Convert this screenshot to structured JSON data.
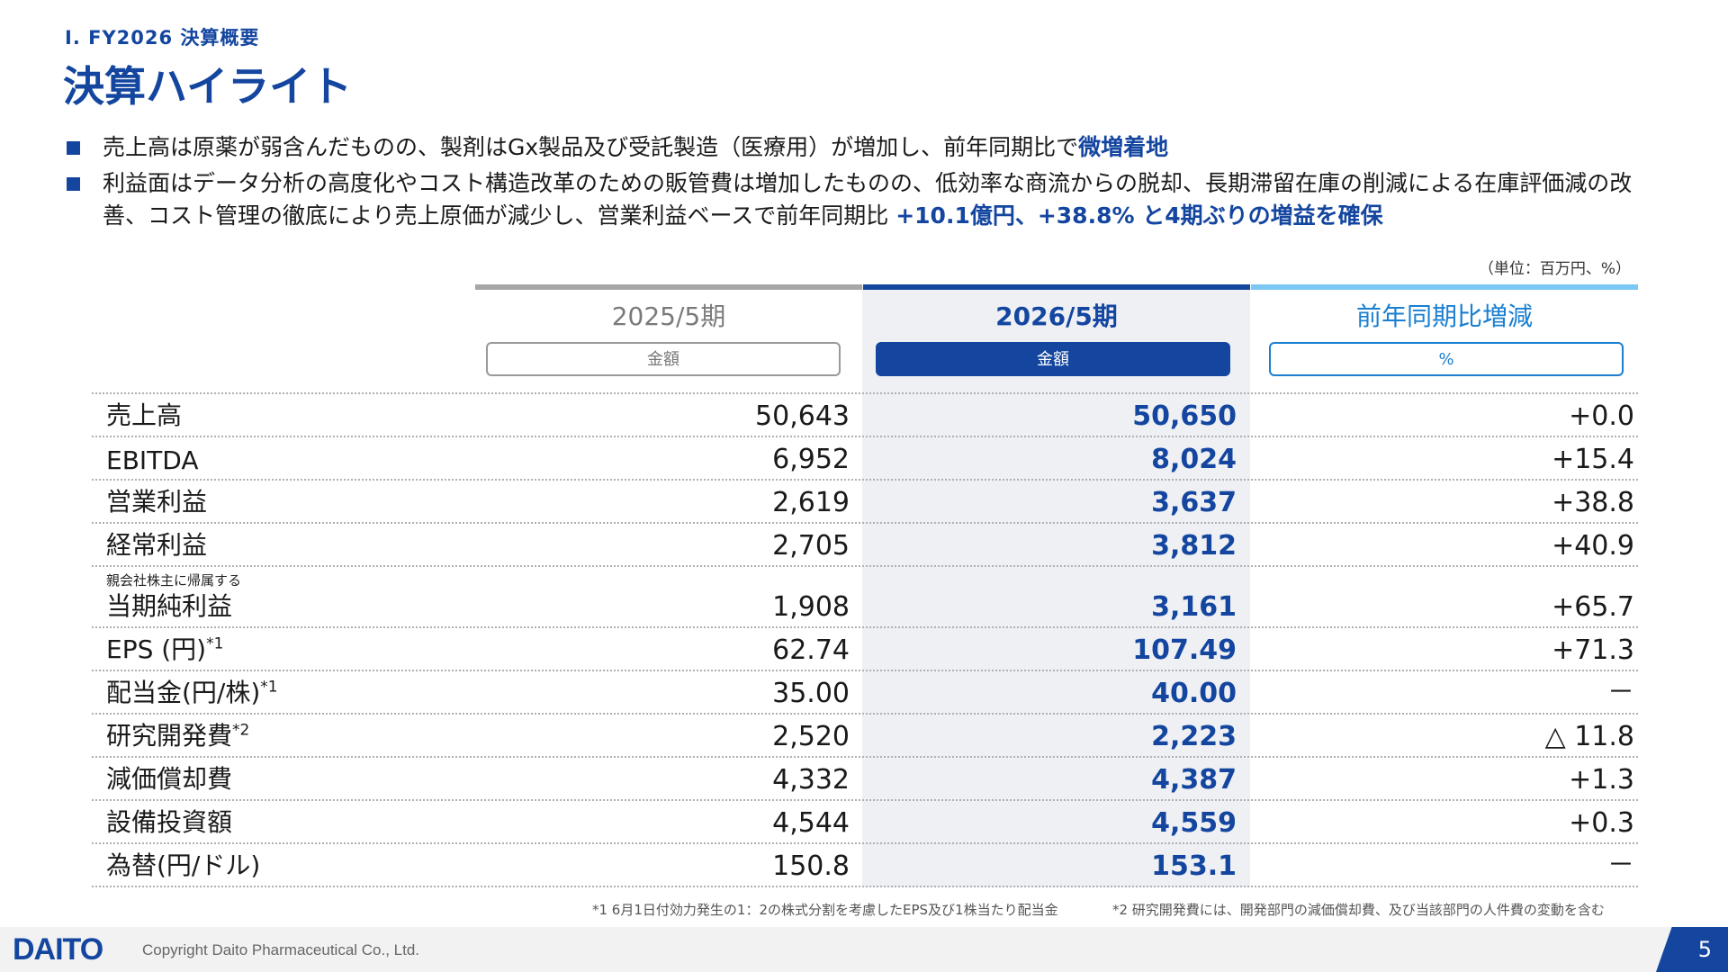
{
  "header": {
    "section": "Ⅰ. FY2026 決算概要",
    "title": "決算ハイライト"
  },
  "bullets": [
    {
      "pre": "売上高は原薬が弱含んだものの、製剤はGx製品及び受託製造（医療用）が増加し、前年同期比で",
      "hl": "微増着地",
      "post": ""
    },
    {
      "pre": "利益面はデータ分析の高度化やコスト構造改革のための販管費は増加したものの、低効率な商流からの脱却、長期滞留在庫の削減による在庫評価減の改善、コスト管理の徹底により売上原価が減少し、営業利益ベースで前年同期比 ",
      "hl": "+10.1億円、+38.8% と4期ぶりの増益を確保",
      "post": ""
    }
  ],
  "unit": "（単位：百万円、%）",
  "columns": {
    "prev": {
      "title": "2025/5期",
      "sub": "金額"
    },
    "curr": {
      "title": "2026/5期",
      "sub": "金額"
    },
    "diff": {
      "title": "前年同期比増減",
      "sub": "%"
    }
  },
  "rows": [
    {
      "label": "売上高",
      "note": "",
      "sub": "",
      "prev": "50,643",
      "curr": "50,650",
      "diff": "+0.0"
    },
    {
      "label": "EBITDA",
      "note": "",
      "sub": "",
      "prev": "6,952",
      "curr": "8,024",
      "diff": "+15.4"
    },
    {
      "label": "営業利益",
      "note": "",
      "sub": "",
      "prev": "2,619",
      "curr": "3,637",
      "diff": "+38.8"
    },
    {
      "label": "経常利益",
      "note": "",
      "sub": "",
      "prev": "2,705",
      "curr": "3,812",
      "diff": "+40.9"
    },
    {
      "label": "当期純利益",
      "note": "",
      "sub": "親会社株主に帰属する",
      "prev": "1,908",
      "curr": "3,161",
      "diff": "+65.7"
    },
    {
      "label": "EPS (円)",
      "note": "*1",
      "sub": "",
      "prev": "62.74",
      "curr": "107.49",
      "diff": "+71.3"
    },
    {
      "label": "配当金(円/株)",
      "note": "*1",
      "sub": "",
      "prev": "35.00",
      "curr": "40.00",
      "diff": "－"
    },
    {
      "label": "研究開発費",
      "note": "*2",
      "sub": "",
      "prev": "2,520",
      "curr": "2,223",
      "diff": "△ 11.8"
    },
    {
      "label": "減価償却費",
      "note": "",
      "sub": "",
      "prev": "4,332",
      "curr": "4,387",
      "diff": "+1.3"
    },
    {
      "label": "設備投資額",
      "note": "",
      "sub": "",
      "prev": "4,544",
      "curr": "4,559",
      "diff": "+0.3"
    },
    {
      "label": "為替(円/ドル)",
      "note": "",
      "sub": "",
      "prev": "150.8",
      "curr": "153.1",
      "diff": "－"
    }
  ],
  "footnotes": [
    "*1 6月1日付効力発生の1：2の株式分割を考慮したEPS及び1株当たり配当金",
    "*2 研究開発費には、開発部門の減価償却費、及び当該部門の人件費の変動を含む"
  ],
  "footer": {
    "logo": "DAITO",
    "copyright": "Copyright  Daito Pharmaceutical Co., Ltd.",
    "page": "5"
  },
  "colors": {
    "accent": "#1446a0",
    "light_accent": "#7cc8f4",
    "neutral": "#a6a6a6"
  }
}
